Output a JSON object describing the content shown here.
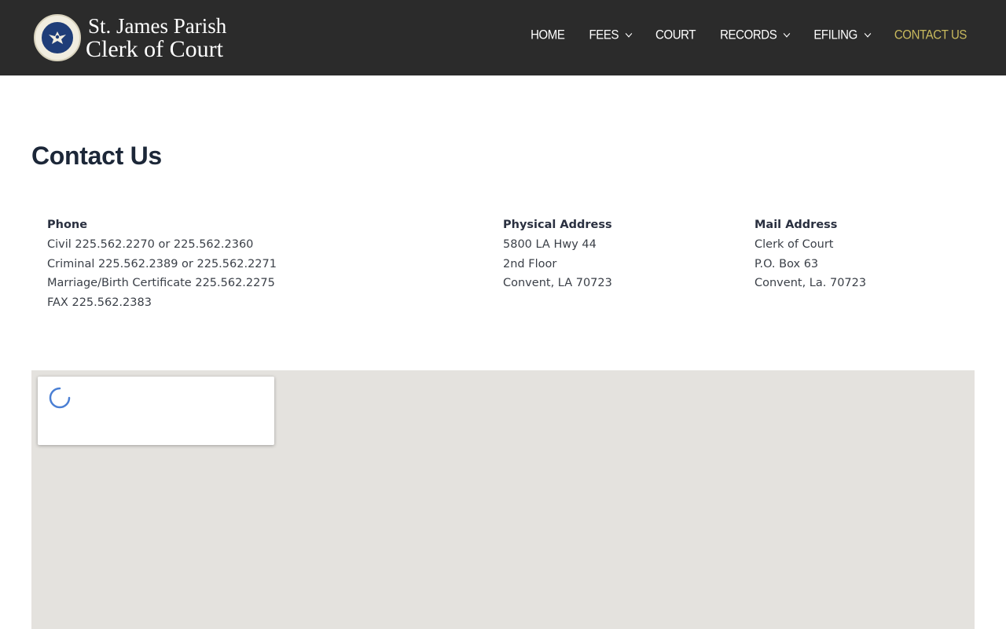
{
  "site": {
    "title_line1": "St. James Parish",
    "title_line2": "Clerk of Court"
  },
  "nav": [
    {
      "label": "HOME",
      "has_dropdown": false,
      "active": false
    },
    {
      "label": "FEES",
      "has_dropdown": true,
      "active": false
    },
    {
      "label": "COURT",
      "has_dropdown": false,
      "active": false
    },
    {
      "label": "RECORDS",
      "has_dropdown": true,
      "active": false
    },
    {
      "label": "EFILING",
      "has_dropdown": true,
      "active": false
    },
    {
      "label": "CONTACT US",
      "has_dropdown": false,
      "active": true
    }
  ],
  "page": {
    "title": "Contact Us"
  },
  "contact": {
    "phone": {
      "heading": "Phone",
      "lines": [
        "Civil 225.562.2270 or 225.562.2360",
        "Criminal 225.562.2389 or 225.562.2271",
        "Marriage/Birth Certificate 225.562.2275",
        "FAX 225.562.2383"
      ]
    },
    "physical": {
      "heading": "Physical Address",
      "lines": [
        "5800 LA Hwy 44",
        "2nd Floor",
        "Convent, LA 70723"
      ]
    },
    "mail": {
      "heading": "Mail Address",
      "lines": [
        "Clerk of Court",
        "P.O. Box 63",
        "Convent, La. 70723"
      ]
    }
  },
  "colors": {
    "header_bg": "#2b2b2b",
    "nav_active": "#c8b95d",
    "title": "#1c2738",
    "map_bg": "#e4e2de",
    "spinner": "#4a7fd4"
  },
  "icons": {
    "logo": "parish-seal-icon",
    "dropdown": "chevron-down-icon",
    "loading": "loading-spinner-icon"
  }
}
